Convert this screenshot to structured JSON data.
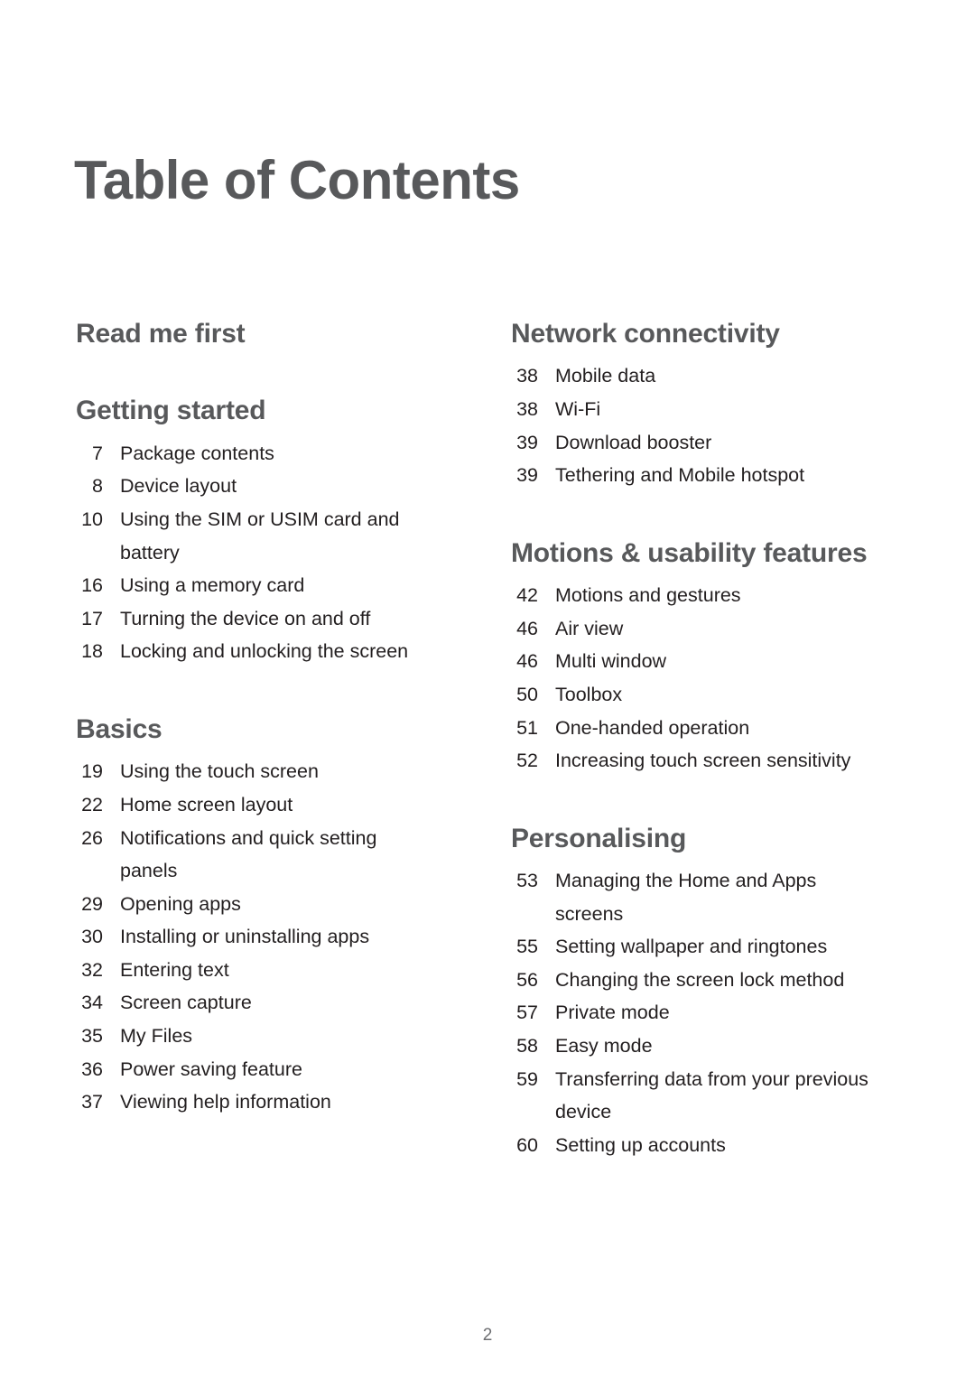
{
  "page_title": "Table of Contents",
  "folio": "2",
  "columns": {
    "left": [
      {
        "heading": "Read me first",
        "entries": []
      },
      {
        "heading": "Getting started",
        "entries": [
          {
            "page": "7",
            "title": "Package contents"
          },
          {
            "page": "8",
            "title": "Device layout"
          },
          {
            "page": "10",
            "title": "Using the SIM or USIM card and battery"
          },
          {
            "page": "16",
            "title": "Using a memory card"
          },
          {
            "page": "17",
            "title": "Turning the device on and off"
          },
          {
            "page": "18",
            "title": "Locking and unlocking the screen"
          }
        ]
      },
      {
        "heading": "Basics",
        "entries": [
          {
            "page": "19",
            "title": "Using the touch screen"
          },
          {
            "page": "22",
            "title": "Home screen layout"
          },
          {
            "page": "26",
            "title": "Notifications and quick setting panels"
          },
          {
            "page": "29",
            "title": "Opening apps"
          },
          {
            "page": "30",
            "title": "Installing or uninstalling apps"
          },
          {
            "page": "32",
            "title": "Entering text"
          },
          {
            "page": "34",
            "title": "Screen capture"
          },
          {
            "page": "35",
            "title": "My Files"
          },
          {
            "page": "36",
            "title": "Power saving feature"
          },
          {
            "page": "37",
            "title": "Viewing help information"
          }
        ]
      }
    ],
    "right": [
      {
        "heading": "Network connectivity",
        "entries": [
          {
            "page": "38",
            "title": "Mobile data"
          },
          {
            "page": "38",
            "title": "Wi-Fi"
          },
          {
            "page": "39",
            "title": "Download booster"
          },
          {
            "page": "39",
            "title": "Tethering and Mobile hotspot"
          }
        ]
      },
      {
        "heading": "Motions & usability features",
        "entries": [
          {
            "page": "42",
            "title": "Motions and gestures"
          },
          {
            "page": "46",
            "title": "Air view"
          },
          {
            "page": "46",
            "title": "Multi window"
          },
          {
            "page": "50",
            "title": "Toolbox"
          },
          {
            "page": "51",
            "title": "One-handed operation"
          },
          {
            "page": "52",
            "title": "Increasing touch screen sensitivity"
          }
        ]
      },
      {
        "heading": "Personalising",
        "entries": [
          {
            "page": "53",
            "title": "Managing the Home and Apps screens"
          },
          {
            "page": "55",
            "title": "Setting wallpaper and ringtones"
          },
          {
            "page": "56",
            "title": "Changing the screen lock method"
          },
          {
            "page": "57",
            "title": "Private mode"
          },
          {
            "page": "58",
            "title": "Easy mode"
          },
          {
            "page": "59",
            "title": "Transferring data from your previous device"
          },
          {
            "page": "60",
            "title": "Setting up accounts"
          }
        ]
      }
    ]
  },
  "colors": {
    "heading": "#58595b",
    "body": "#231f20",
    "folio": "#6d6e71",
    "background": "#ffffff"
  }
}
